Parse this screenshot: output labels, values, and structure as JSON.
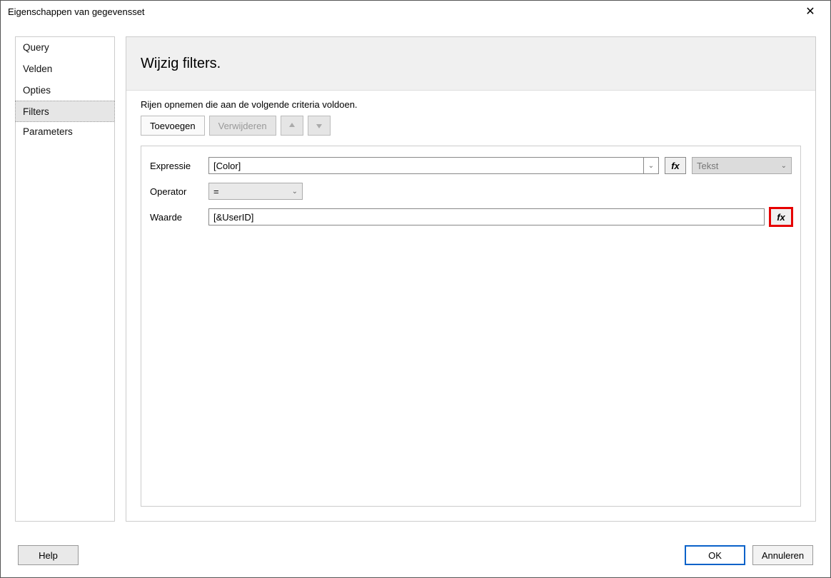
{
  "window": {
    "title": "Eigenschappen van gegevensset",
    "close_icon_text": "✕"
  },
  "sidebar": {
    "items": [
      {
        "label": "Query",
        "selected": false
      },
      {
        "label": "Velden",
        "selected": false
      },
      {
        "label": "Opties",
        "selected": false
      },
      {
        "label": "Filters",
        "selected": true
      },
      {
        "label": "Parameters",
        "selected": false
      }
    ]
  },
  "main": {
    "heading": "Wijzig filters.",
    "instruction": "Rijen opnemen die aan de volgende criteria voldoen.",
    "toolbar": {
      "add": "Toevoegen",
      "delete": "Verwijderen",
      "up_icon": "▲",
      "down_icon": "▼"
    },
    "filter": {
      "expression_label": "Expressie",
      "expression_value": "[Color]",
      "fx_label": "fx",
      "type_value": "Tekst",
      "operator_label": "Operator",
      "operator_value": "=",
      "value_label": "Waarde",
      "value_value": "[&UserID]"
    }
  },
  "footer": {
    "help": "Help",
    "ok": "OK",
    "cancel": "Annuleren"
  },
  "chevron": "⌄"
}
